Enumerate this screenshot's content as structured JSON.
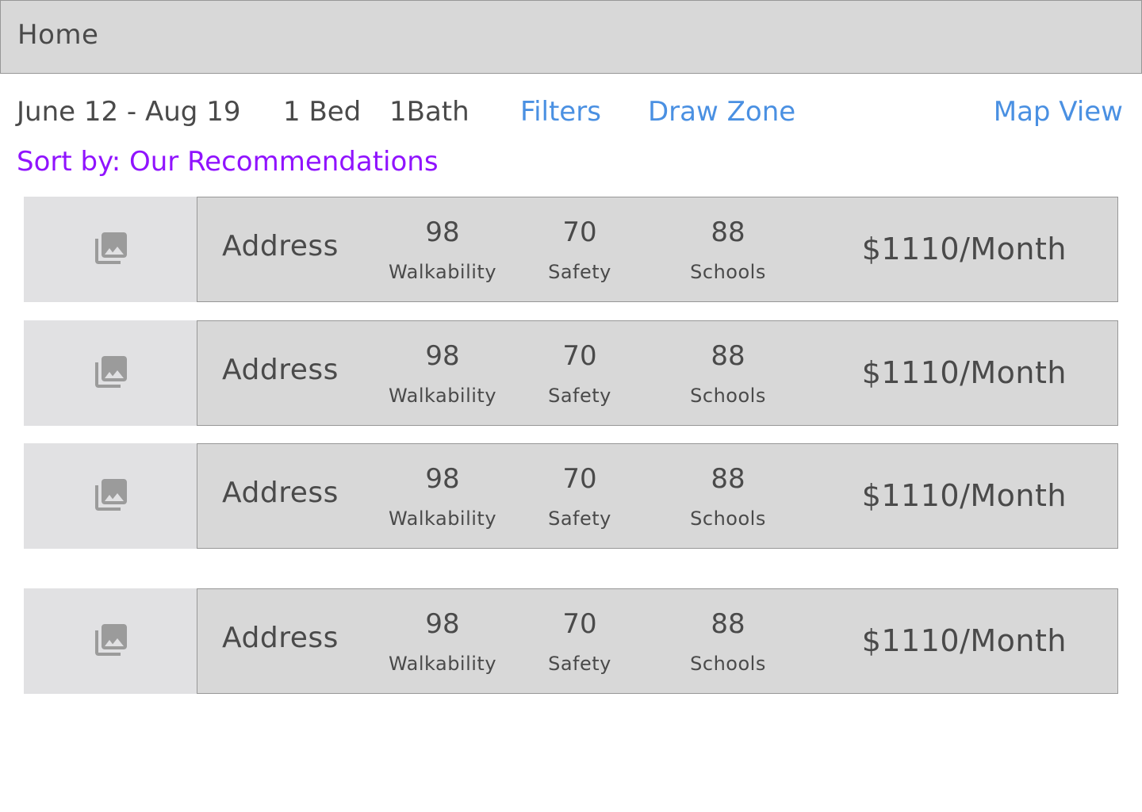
{
  "header": {
    "title": "Home"
  },
  "toolbar": {
    "dates": "June 12 - Aug 19",
    "beds": "1 Bed",
    "baths": "1Bath",
    "filters": "Filters",
    "draw_zone": "Draw Zone",
    "map_view": "Map View"
  },
  "sort": {
    "label": "Sort by: Our Recommendations"
  },
  "colors": {
    "link": "#4a90e2",
    "sort": "#9013fe",
    "text": "#4a4a4a",
    "panel": "#d8d8d8",
    "thumb": "#e1e1e3",
    "icon": "#9b9b9b"
  },
  "listings": [
    {
      "image_icon": "photo-library-icon",
      "address": "Address",
      "walkability": "98",
      "walkability_label": "Walkability",
      "safety": "70",
      "safety_label": "Safety",
      "schools": "88",
      "schools_label": "Schools",
      "price": "$1110/Month"
    },
    {
      "image_icon": "photo-library-icon",
      "address": "Address",
      "walkability": "98",
      "walkability_label": "Walkability",
      "safety": "70",
      "safety_label": "Safety",
      "schools": "88",
      "schools_label": "Schools",
      "price": "$1110/Month"
    },
    {
      "image_icon": "photo-library-icon",
      "address": "Address",
      "walkability": "98",
      "walkability_label": "Walkability",
      "safety": "70",
      "safety_label": "Safety",
      "schools": "88",
      "schools_label": "Schools",
      "price": "$1110/Month"
    },
    {
      "image_icon": "photo-library-icon",
      "address": "Address",
      "walkability": "98",
      "walkability_label": "Walkability",
      "safety": "70",
      "safety_label": "Safety",
      "schools": "88",
      "schools_label": "Schools",
      "price": "$1110/Month"
    }
  ]
}
